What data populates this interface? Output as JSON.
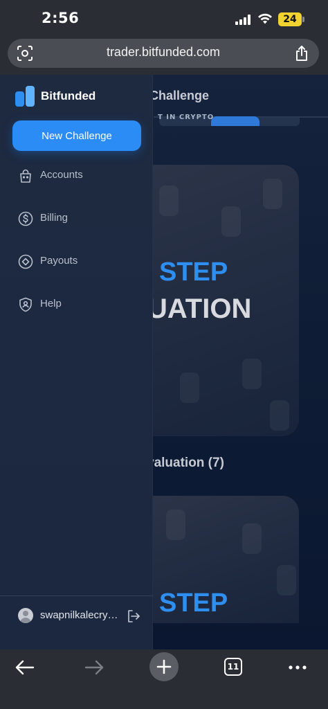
{
  "status_bar": {
    "time": "2:56",
    "battery": "24"
  },
  "browser": {
    "url": "trader.bitfunded.com",
    "tab_count": "11"
  },
  "background_page": {
    "title": "Challenge",
    "banner_text": "T IN CRYPTO",
    "card_1_line1": "STEP",
    "card_1_line2": "UATION",
    "section_label": "valuation (7)",
    "card_2_line1": "STEP"
  },
  "sidebar": {
    "brand": "Bitfunded",
    "new_challenge_label": "New Challenge",
    "items": [
      {
        "label": "Accounts",
        "icon": "bag-icon"
      },
      {
        "label": "Billing",
        "icon": "dollar-circle-icon"
      },
      {
        "label": "Payouts",
        "icon": "diamond-icon"
      },
      {
        "label": "Help",
        "icon": "shield-user-icon"
      }
    ],
    "username": "swapnilkalecrypto",
    "accent_color": "#2b8cf6"
  }
}
